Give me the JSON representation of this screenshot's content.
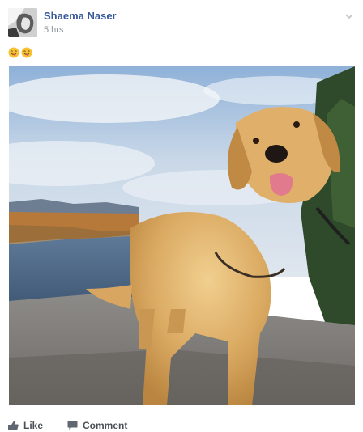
{
  "post": {
    "author": "Shaema Naser",
    "time": "5 hrs",
    "text_emojis": [
      "smiling-face-with-tongue-emoji",
      "smiling-face-with-tongue-emoji"
    ]
  },
  "actions": {
    "like_label": "Like",
    "comment_label": "Comment"
  },
  "colors": {
    "author_link": "#365899",
    "timestamp": "#90949c",
    "action_text": "#4b4f56"
  }
}
